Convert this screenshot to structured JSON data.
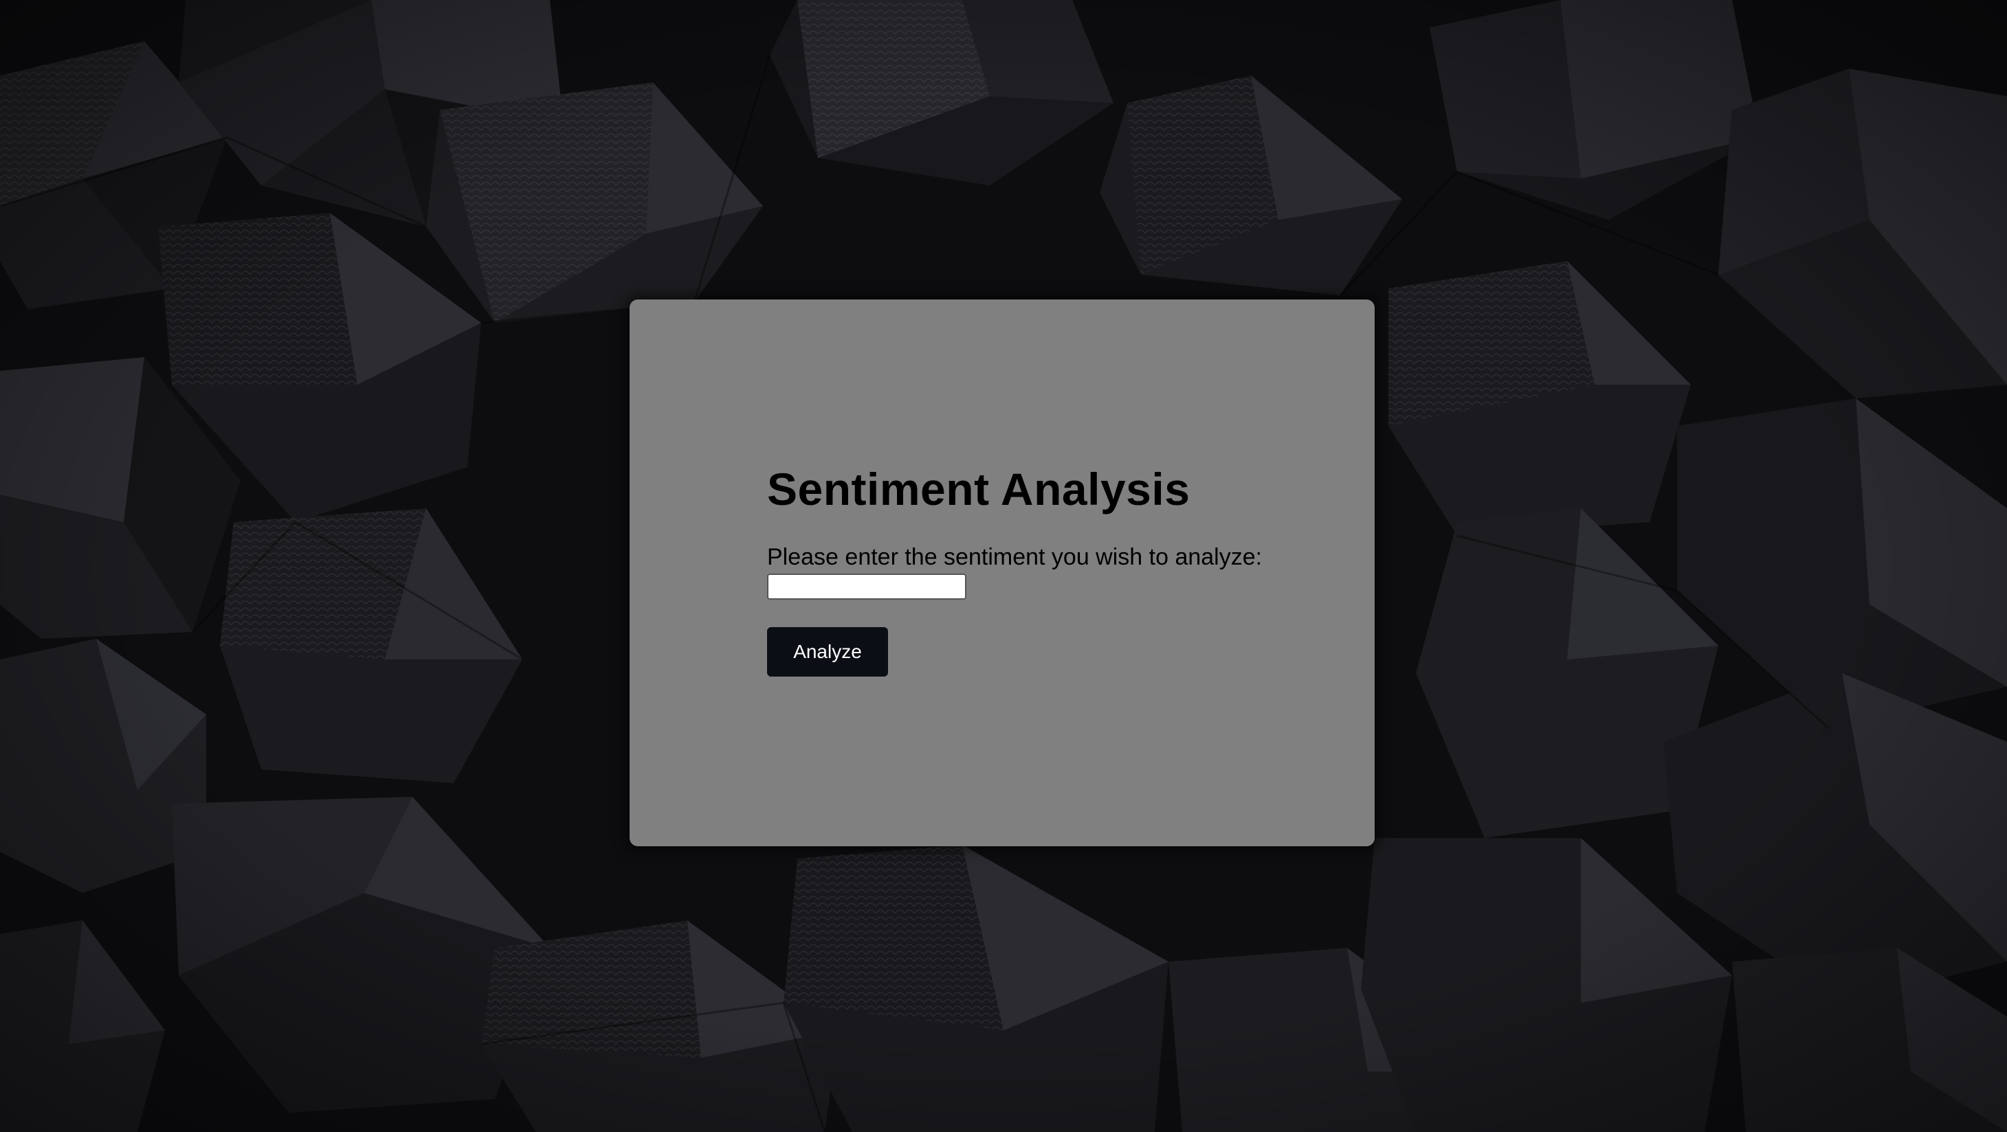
{
  "background": {
    "pattern": "dark-3d-polyhedra",
    "color": "#0c0c0f"
  },
  "form": {
    "title": "Sentiment Analysis",
    "prompt": "Please enter the sentiment you wish to analyze:",
    "input": {
      "value": "",
      "placeholder": ""
    },
    "submit_label": "Analyze"
  },
  "colors": {
    "card": "#808080",
    "button": "#0b0f15",
    "button_text": "#ffffff",
    "text": "#000000"
  }
}
